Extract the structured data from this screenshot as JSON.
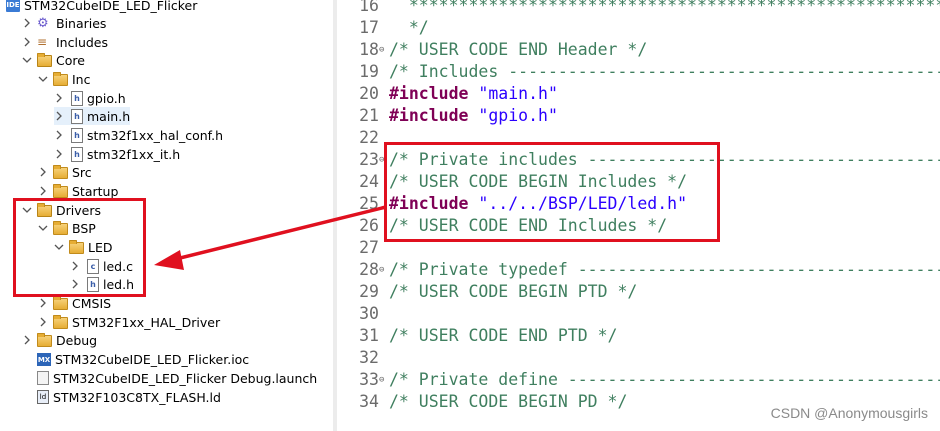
{
  "project_tree": {
    "project_name": "STM32CubeIDE_LED_Flicker",
    "items": [
      {
        "label": "Binaries",
        "icon": "binaries-icon"
      },
      {
        "label": "Includes",
        "icon": "includes-icon"
      },
      {
        "label": "Core",
        "icon": "folder-icon"
      },
      {
        "label": "Inc",
        "icon": "folder-icon"
      },
      {
        "label": "gpio.h",
        "icon": "header-file-icon"
      },
      {
        "label": "main.h",
        "icon": "header-file-icon"
      },
      {
        "label": "stm32f1xx_hal_conf.h",
        "icon": "header-file-icon"
      },
      {
        "label": "stm32f1xx_it.h",
        "icon": "header-file-icon"
      },
      {
        "label": "Src",
        "icon": "folder-icon"
      },
      {
        "label": "Startup",
        "icon": "folder-icon"
      },
      {
        "label": "Drivers",
        "icon": "folder-icon"
      },
      {
        "label": "BSP",
        "icon": "folder-icon"
      },
      {
        "label": "LED",
        "icon": "folder-icon"
      },
      {
        "label": "led.c",
        "icon": "c-file-icon"
      },
      {
        "label": "led.h",
        "icon": "header-file-icon"
      },
      {
        "label": "CMSIS",
        "icon": "folder-icon"
      },
      {
        "label": "STM32F1xx_HAL_Driver",
        "icon": "folder-icon"
      },
      {
        "label": "Debug",
        "icon": "folder-icon"
      },
      {
        "label": "STM32CubeIDE_LED_Flicker.ioc",
        "icon": "ioc-file-icon"
      },
      {
        "label": "STM32CubeIDE_LED_Flicker Debug.launch",
        "icon": "launch-file-icon"
      },
      {
        "label": "STM32F103C8TX_FLASH.ld",
        "icon": "linker-file-icon"
      }
    ]
  },
  "editor": {
    "lines": [
      {
        "num": "16",
        "fold": "",
        "parts": [
          {
            "t": "  ******************************************************************************",
            "c": "comment"
          }
        ]
      },
      {
        "num": "17",
        "fold": "",
        "parts": [
          {
            "t": "  */",
            "c": "comment"
          }
        ]
      },
      {
        "num": "18",
        "fold": "⊖",
        "parts": [
          {
            "t": "/* USER CODE END Header */",
            "c": "comment"
          }
        ]
      },
      {
        "num": "19",
        "fold": "",
        "parts": [
          {
            "t": "/* Includes ------------------------------------------------------------------*/",
            "c": "comment"
          }
        ]
      },
      {
        "num": "20",
        "fold": "",
        "parts": [
          {
            "t": "#include",
            "c": "kw"
          },
          {
            "t": " ",
            "c": ""
          },
          {
            "t": "\"main.h\"",
            "c": "str"
          }
        ]
      },
      {
        "num": "21",
        "fold": "",
        "parts": [
          {
            "t": "#include",
            "c": "kw"
          },
          {
            "t": " ",
            "c": ""
          },
          {
            "t": "\"gpio.h\"",
            "c": "str"
          }
        ]
      },
      {
        "num": "22",
        "fold": "",
        "parts": []
      },
      {
        "num": "23",
        "fold": "⊖",
        "parts": [
          {
            "t": "/* Private includes ----------------------------------------------------------*/",
            "c": "comment"
          }
        ]
      },
      {
        "num": "24",
        "fold": "",
        "parts": [
          {
            "t": "/* USER CODE BEGIN Includes */",
            "c": "comment"
          }
        ]
      },
      {
        "num": "25",
        "fold": "",
        "parts": [
          {
            "t": "#include",
            "c": "kw"
          },
          {
            "t": " ",
            "c": ""
          },
          {
            "t": "\"../../BSP/LED/led.h\"",
            "c": "str"
          }
        ]
      },
      {
        "num": "26",
        "fold": "",
        "parts": [
          {
            "t": "/* USER CODE END Includes */",
            "c": "comment"
          }
        ]
      },
      {
        "num": "27",
        "fold": "",
        "parts": []
      },
      {
        "num": "28",
        "fold": "⊖",
        "parts": [
          {
            "t": "/* Private typedef -----------------------------------------------------------*/",
            "c": "comment"
          }
        ]
      },
      {
        "num": "29",
        "fold": "",
        "parts": [
          {
            "t": "/* USER CODE BEGIN PTD */",
            "c": "comment"
          }
        ]
      },
      {
        "num": "30",
        "fold": "",
        "parts": []
      },
      {
        "num": "31",
        "fold": "",
        "parts": [
          {
            "t": "/* USER CODE END PTD */",
            "c": "comment"
          }
        ]
      },
      {
        "num": "32",
        "fold": "",
        "parts": []
      },
      {
        "num": "33",
        "fold": "⊖",
        "parts": [
          {
            "t": "/* Private define ------------------------------------------------------------*/",
            "c": "comment"
          }
        ]
      },
      {
        "num": "34",
        "fold": "",
        "parts": [
          {
            "t": "/* USER CODE BEGIN PD */",
            "c": "comment"
          }
        ]
      }
    ]
  },
  "watermark": "CSDN @Anonymousgirls",
  "colors": {
    "annotation_red": "#e0101f",
    "comment": "#3f7f5f",
    "keyword": "#7f0055",
    "string": "#2a00ff"
  }
}
